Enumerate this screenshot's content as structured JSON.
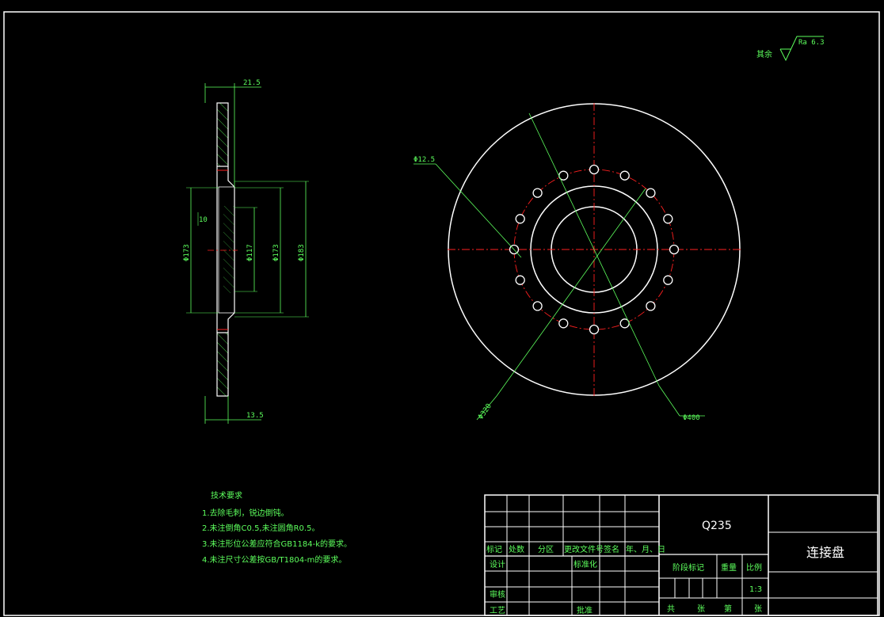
{
  "roughness": {
    "prefix": "其余",
    "value": "Ra 6.3"
  },
  "side_view_dims": {
    "top_width": "21.5",
    "bottom_width": "13.5",
    "step": "10",
    "d_left": "Φ173",
    "d_inner": "Φ117",
    "d_mid": "Φ173",
    "d_outer": "Φ183"
  },
  "front_view_dims": {
    "hole_dia": "Φ12.5",
    "bolt_circle": "Φ320",
    "outer_dia": "Φ400",
    "hole_count": 16
  },
  "tech_notes": {
    "title": "技术要求",
    "items": [
      "1.去除毛刺，锐边倒钝。",
      "2.未注倒角C0.5,未注圆角R0.5。",
      "3.未注形位公差应符合GB1184-k的要求。",
      "4.未注尺寸公差按GB/T1804-m的要求。"
    ]
  },
  "title_block": {
    "material": "Q235",
    "part_name": "连接盘",
    "rev_headers": [
      "标记",
      "处数",
      "分区",
      "更改文件号",
      "签名",
      "年、月、日"
    ],
    "design": "设计",
    "standardize": "标准化",
    "review": "审核",
    "process": "工艺",
    "approve": "批准",
    "stage_mark": "阶段标记",
    "weight": "重量",
    "scale_label": "比例",
    "scale_value": "1:3",
    "total_label": "共",
    "sheet_label": "张",
    "page_label": "第",
    "page_sheet": "张"
  },
  "colors": {
    "outline": "#ffffff",
    "dimension": "#00e000",
    "centerline": "#ff2020"
  }
}
